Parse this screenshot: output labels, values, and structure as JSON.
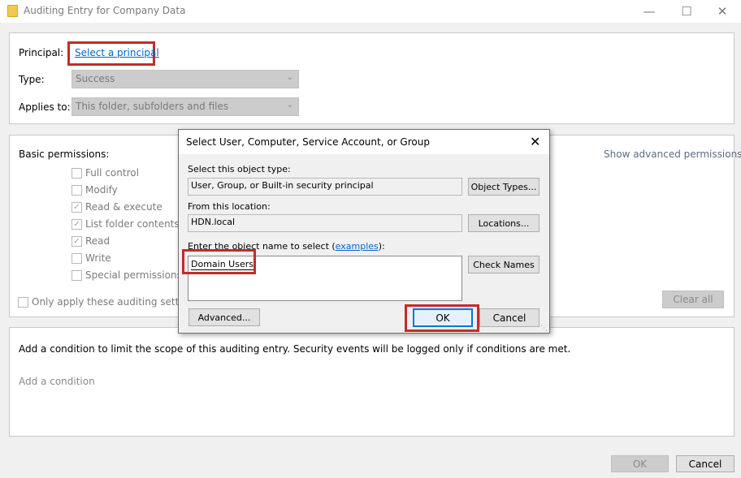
{
  "window": {
    "title": "Auditing Entry for Company Data",
    "minimize_glyph": "—",
    "maximize_glyph": "☐",
    "close_glyph": "✕"
  },
  "principal": {
    "label": "Principal:",
    "link": "Select a principal",
    "type_label": "Type:",
    "type_value": "Success",
    "applies_label": "Applies to:",
    "applies_value": "This folder, subfolders and files"
  },
  "permissions": {
    "heading": "Basic permissions:",
    "advanced_link": "Show advanced permissions",
    "items": [
      {
        "label": "Full control",
        "checked": false
      },
      {
        "label": "Modify",
        "checked": false
      },
      {
        "label": "Read & execute",
        "checked": true
      },
      {
        "label": "List folder contents",
        "checked": true
      },
      {
        "label": "Read",
        "checked": true
      },
      {
        "label": "Write",
        "checked": false
      },
      {
        "label": "Special permissions",
        "checked": false
      }
    ],
    "only_apply": "Only apply these auditing settings",
    "clear_all": "Clear all"
  },
  "condition": {
    "text": "Add a condition to limit the scope of this auditing entry. Security events will be logged only if conditions are met.",
    "add_link": "Add a condition"
  },
  "footer": {
    "ok": "OK",
    "cancel": "Cancel"
  },
  "dialog": {
    "title": "Select User, Computer, Service Account, or Group",
    "object_type_label": "Select this object type:",
    "object_type_value": "User, Group, or Built-in security principal",
    "object_types_button": "Object Types...",
    "location_label": "From this location:",
    "location_value": "HDN.local",
    "locations_button": "Locations...",
    "name_label_prefix": "Enter the object name to select (",
    "name_label_link": "examples",
    "name_label_suffix": "):",
    "name_value": "Domain Users",
    "check_names_button": "Check Names",
    "advanced_button": "Advanced...",
    "ok_button": "OK",
    "cancel_button": "Cancel"
  },
  "colors": {
    "highlight": "#c42b2b",
    "link": "#0066cc",
    "focus": "#0078d7"
  }
}
